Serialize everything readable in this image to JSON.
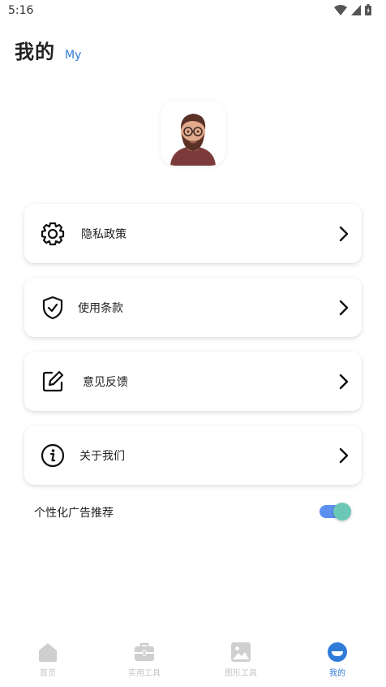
{
  "status_bar": {
    "time": "5:16"
  },
  "header": {
    "title": "我的",
    "subtitle": "My"
  },
  "menu": [
    {
      "label": "隐私政策",
      "icon": "gear-icon"
    },
    {
      "label": "使用条款",
      "icon": "shield-check-icon"
    },
    {
      "label": "意见反馈",
      "icon": "edit-icon"
    },
    {
      "label": "关于我们",
      "icon": "info-icon"
    }
  ],
  "ad_toggle": {
    "label": "个性化广告推荐",
    "on": true
  },
  "bottom_nav": [
    {
      "label": "首页",
      "icon": "home-icon"
    },
    {
      "label": "实用工具",
      "icon": "toolbox-icon"
    },
    {
      "label": "图形工具",
      "icon": "image-icon"
    },
    {
      "label": "我的",
      "icon": "profile-icon",
      "active": true
    }
  ],
  "colors": {
    "accent": "#2f7bd8",
    "toggle_track": "#5b8ff0",
    "toggle_knob": "#6cc8b6"
  }
}
